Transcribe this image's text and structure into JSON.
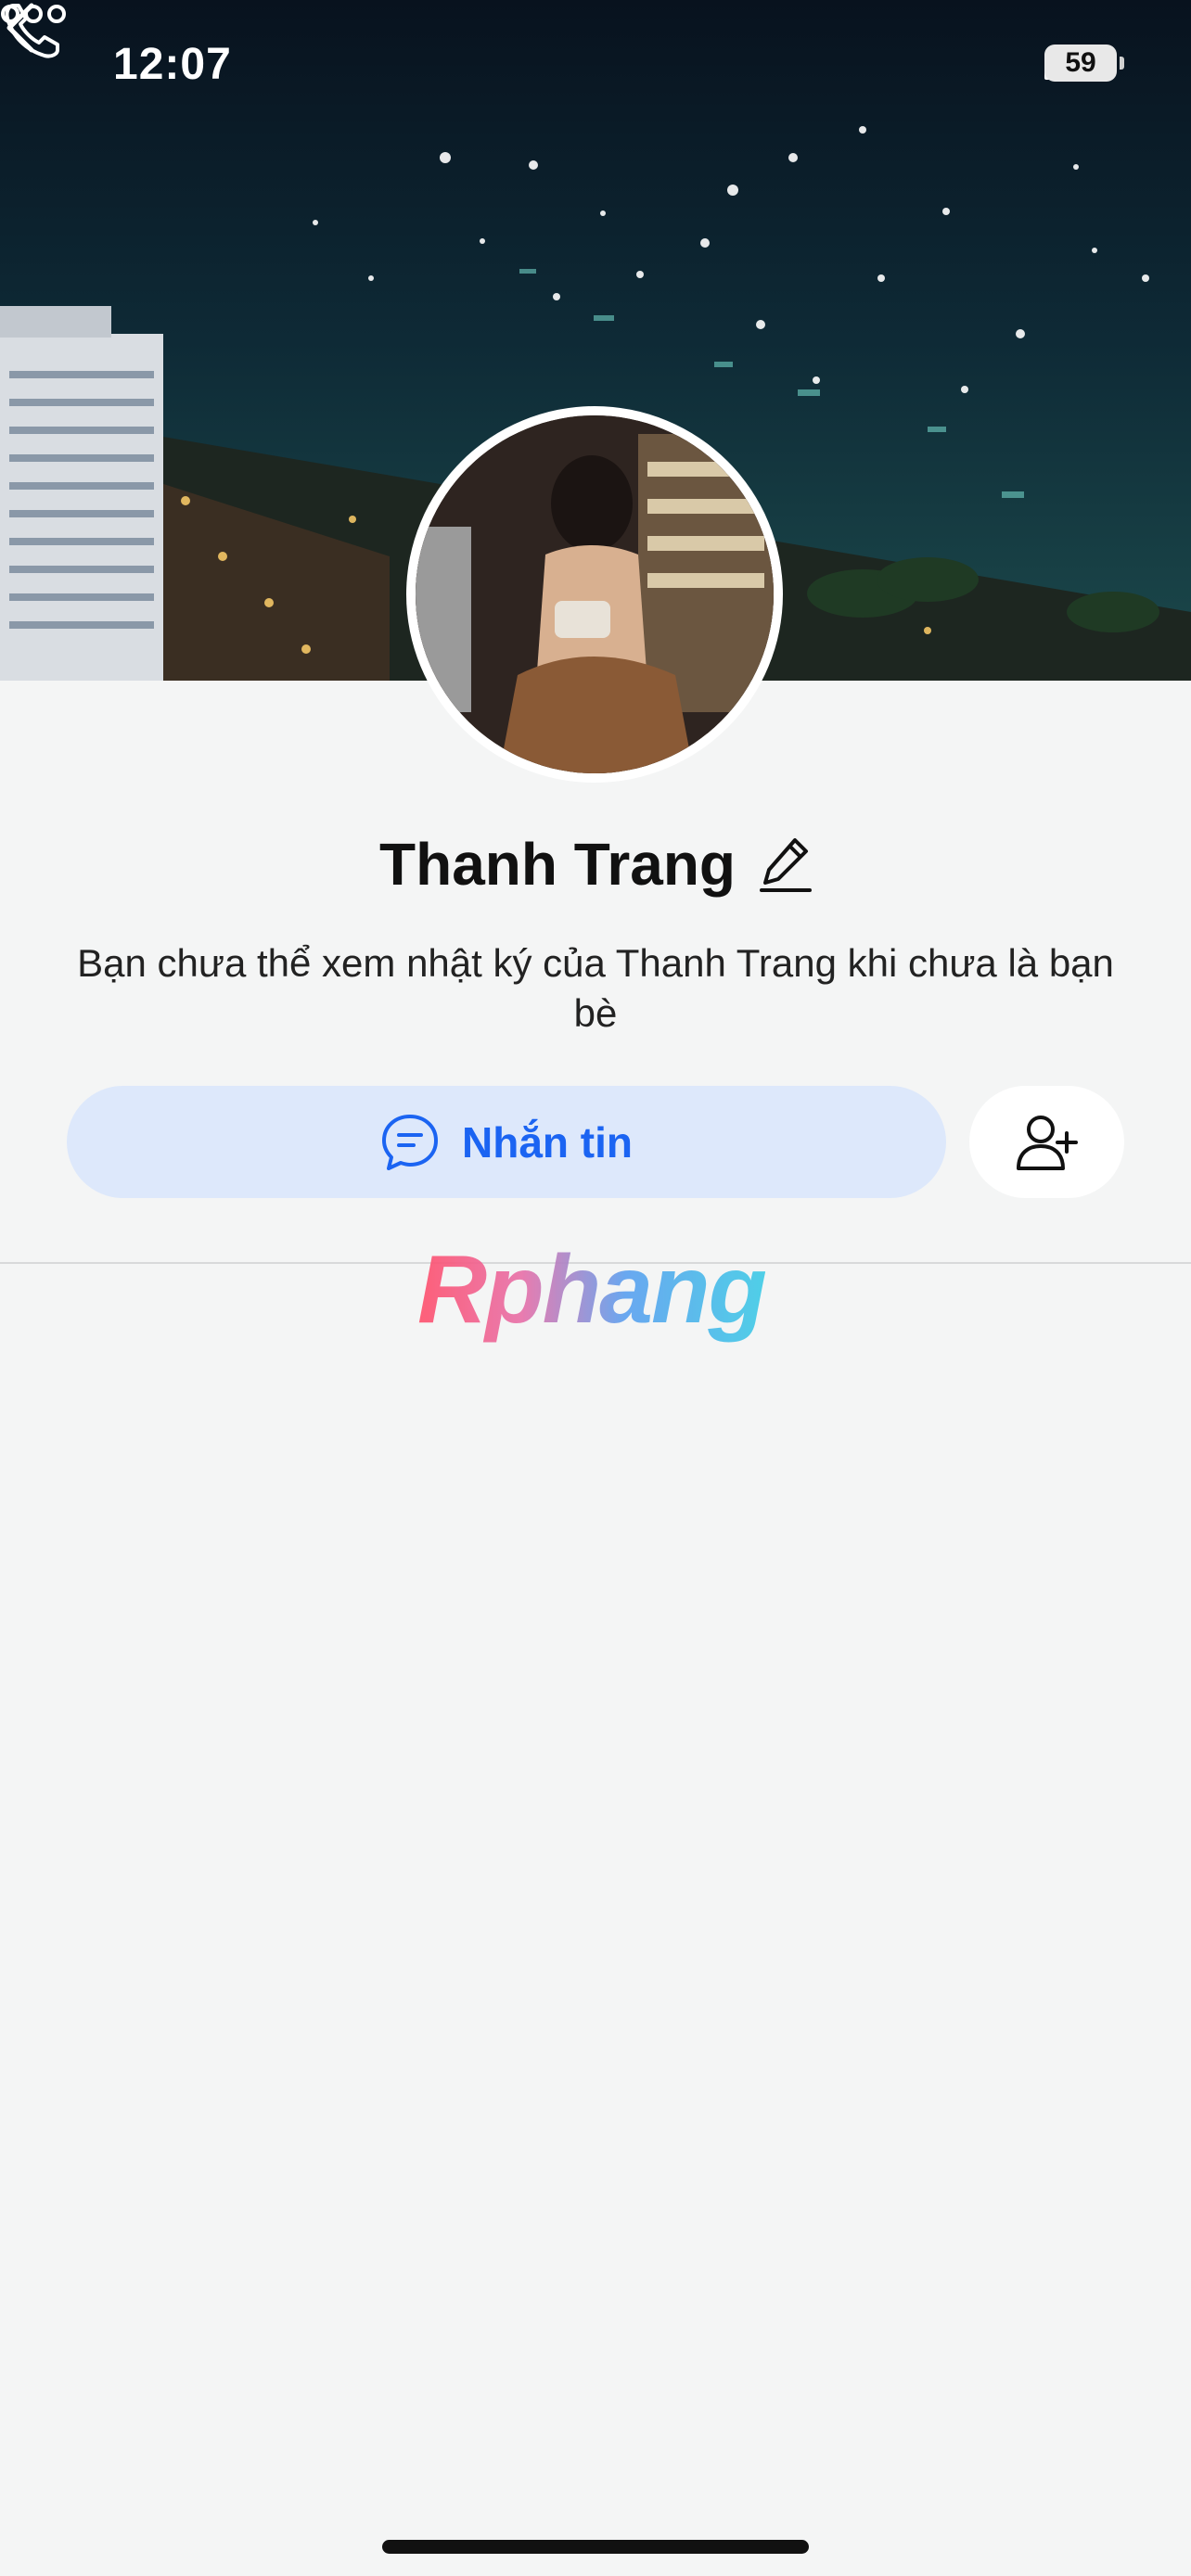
{
  "status_bar": {
    "time": "12:07",
    "battery": "59",
    "icons": [
      "signal-icon",
      "wifi-icon",
      "battery-icon"
    ]
  },
  "nav": {
    "icons": [
      "back-icon",
      "phone-icon",
      "more-icon"
    ]
  },
  "profile": {
    "name": "Thanh Trang",
    "description": "Bạn chưa thể xem nhật ký của Thanh Trang khi chưa là bạn bè"
  },
  "actions": {
    "message_label": "Nhắn tin",
    "message_icon": "chat-icon",
    "add_friend_icon": "add-friend-icon"
  },
  "watermark": "Rphang",
  "colors": {
    "accent": "#1b64f2",
    "message_button_bg": "#dde8fb",
    "page_bg": "#f4f5f5"
  }
}
